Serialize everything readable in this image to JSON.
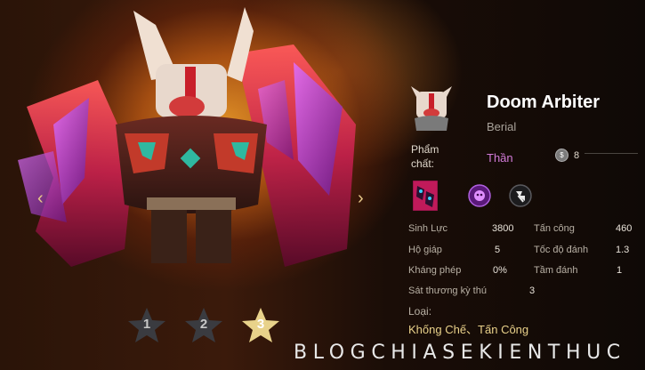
{
  "hero": {
    "name": "Doom Arbiter",
    "subtitle": "Berial",
    "quality_label": "Phẩm chất:",
    "quality_value": "Thần",
    "cost": "8",
    "cost_icon": "coin-icon"
  },
  "nav": {
    "prev_glyph": "‹",
    "next_glyph": "›"
  },
  "star_levels": [
    {
      "label": "1",
      "active": false
    },
    {
      "label": "2",
      "active": false
    },
    {
      "label": "3",
      "active": true
    }
  ],
  "stats": {
    "hp_label": "Sinh Lực",
    "hp": "3800",
    "attack_label": "Tấn công",
    "attack": "460",
    "armor_label": "Hộ giáp",
    "armor": "5",
    "aspd_label": "Tốc độ đánh",
    "aspd": "1.3",
    "mres_label": "Kháng phép",
    "mres": "0%",
    "range_label": "Tầm đánh",
    "range": "1",
    "beast_label": "Sát thương kỳ thú",
    "beast": "3"
  },
  "type": {
    "label": "Loại:",
    "value": "Khống Chế、Tấn Công"
  },
  "watermark": "BLOGCHIASEKIENTHUC",
  "colors": {
    "quality": "#d37bd8",
    "type_value": "#e9d18a",
    "active_star": "#e8d28a",
    "inactive_star": "#3a3b40"
  }
}
